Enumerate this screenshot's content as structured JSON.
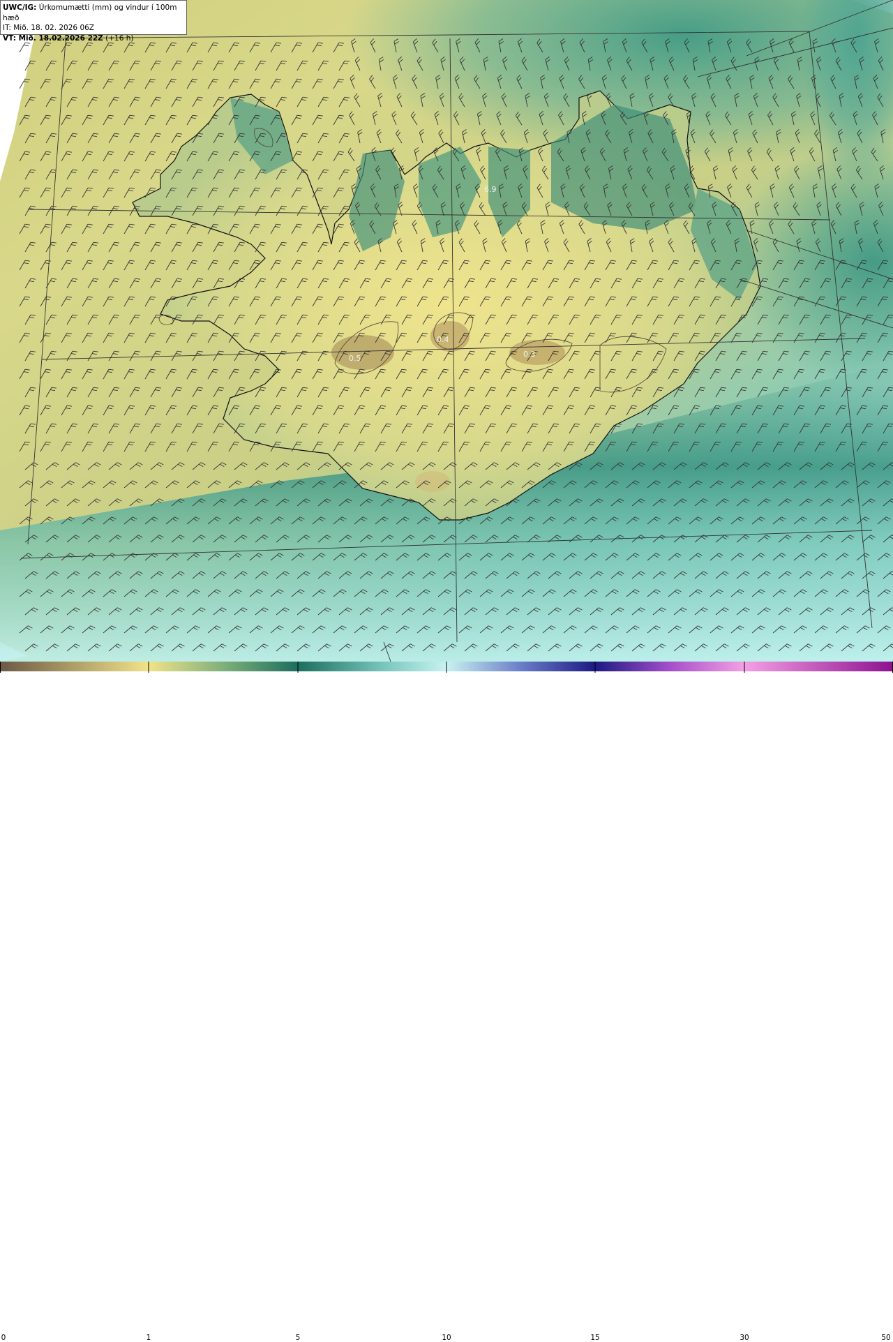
{
  "header": {
    "product_code": "UWC/IG:",
    "product_title": " Úrkomumætti (mm) og vindur í 100m hæð",
    "init_time": "IT: Mið. 18. 02. 2026 06Z",
    "valid_label": "VT:",
    "valid_time": " Mið. 18.02.2026 22Z",
    "lead_time": " (+16 h)"
  },
  "map_labels": [
    {
      "id": "label-vestfirdir-low",
      "text": "6.9"
    },
    {
      "id": "label-langjokull",
      "text": "0.5"
    },
    {
      "id": "label-hofsjokull",
      "text": "0.4"
    },
    {
      "id": "label-vatnajokull",
      "text": "0.3"
    }
  ],
  "legend": {
    "ticks": [
      "0",
      "1",
      "5",
      "10",
      "15",
      "30",
      "50"
    ],
    "colors": {
      "c0": "#6b5a45",
      "c1": "#f1e38a",
      "c5": "#1c6e5e",
      "c10": "#c9f2f0",
      "c15": "#1d1a82",
      "c30": "#f3a0e4",
      "c50": "#8e1190"
    }
  },
  "colors": {
    "land_outline": "#111111",
    "graticule": "#333333",
    "barb": "#333333",
    "sea_dry": "#d6da8e",
    "sea_wet": "#5fb5a5",
    "sea_north": "#4aa08e",
    "sea_south": "#9fdcd4"
  }
}
